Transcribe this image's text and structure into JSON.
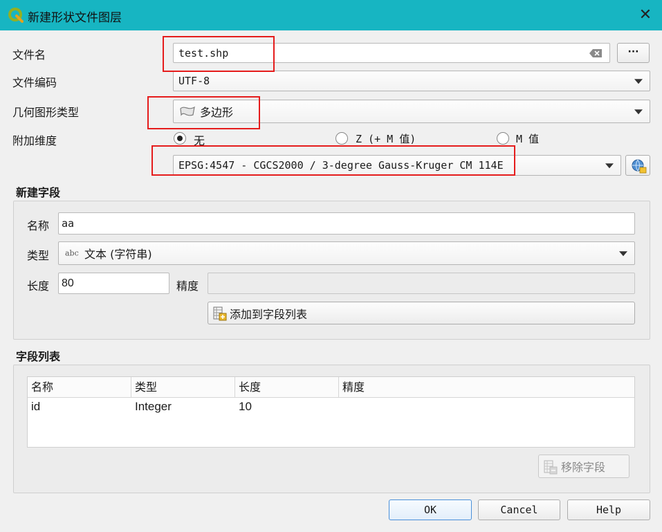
{
  "window": {
    "title": "新建形状文件图层",
    "close_label": "✕"
  },
  "file": {
    "filename_label": "文件名",
    "filename_value": "test.shp",
    "browse_label": "···",
    "encoding_label": "文件编码",
    "encoding_value": "UTF-8"
  },
  "geometry": {
    "label": "几何图形类型",
    "value": "多边形"
  },
  "dimensions": {
    "label": "附加维度",
    "options": [
      {
        "label": "无",
        "checked": true
      },
      {
        "label": "Z (+ M 值)",
        "checked": false
      },
      {
        "label": "M 值",
        "checked": false
      }
    ]
  },
  "crs": {
    "value": "EPSG:4547 - CGCS2000 / 3-degree Gauss-Kruger CM 114E"
  },
  "new_field": {
    "section_title": "新建字段",
    "name_label": "名称",
    "name_value": "aa",
    "type_label": "类型",
    "type_icon_text": "abc",
    "type_value": "文本 (字符串)",
    "length_label": "长度",
    "length_value": "80",
    "precision_label": "精度",
    "precision_value": "",
    "add_button_label": "添加到字段列表"
  },
  "field_list": {
    "section_title": "字段列表",
    "columns": [
      "名称",
      "类型",
      "长度",
      "精度"
    ],
    "rows": [
      [
        "id",
        "Integer",
        "10",
        ""
      ]
    ],
    "remove_button_label": "移除字段"
  },
  "buttons": {
    "ok": "OK",
    "cancel": "Cancel",
    "help": "Help"
  },
  "colors": {
    "titlebar": "#17b5c2",
    "highlight_box": "#e51c1c"
  }
}
